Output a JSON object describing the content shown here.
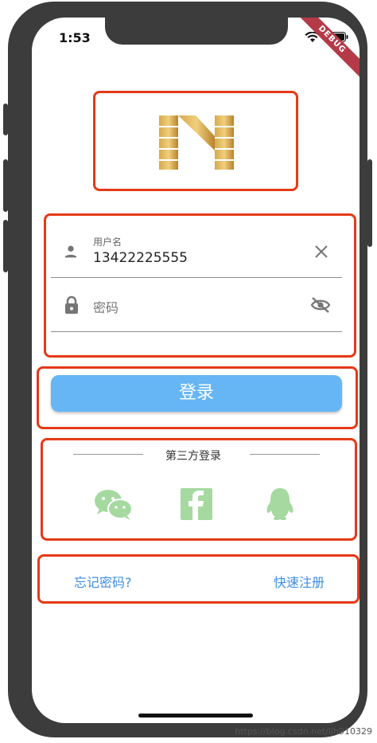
{
  "status_bar": {
    "time": "1:53",
    "debug_banner": "DEBUG"
  },
  "login_form": {
    "username": {
      "label": "用户名",
      "value": "13422225555",
      "icon": "person-icon",
      "clear_icon": "close-icon"
    },
    "password": {
      "placeholder": "密码",
      "icon": "lock-icon",
      "toggle_icon": "visibility-off-icon"
    }
  },
  "login_button": {
    "label": "登录"
  },
  "third_party": {
    "title": "第三方登录",
    "providers": [
      {
        "name": "wechat-icon"
      },
      {
        "name": "facebook-icon"
      },
      {
        "name": "qq-icon"
      }
    ],
    "icon_color": "#a5d9a0"
  },
  "footer_links": {
    "forgot_password": "忘记密码?",
    "quick_register": "快速注册"
  },
  "watermark": "https://blog.csdn.net/ljh910329",
  "colors": {
    "accent": "#66b6f6",
    "annotation_frame": "#e43a17",
    "link": "#3d8fe0",
    "logo_gold": "#c8963a"
  }
}
